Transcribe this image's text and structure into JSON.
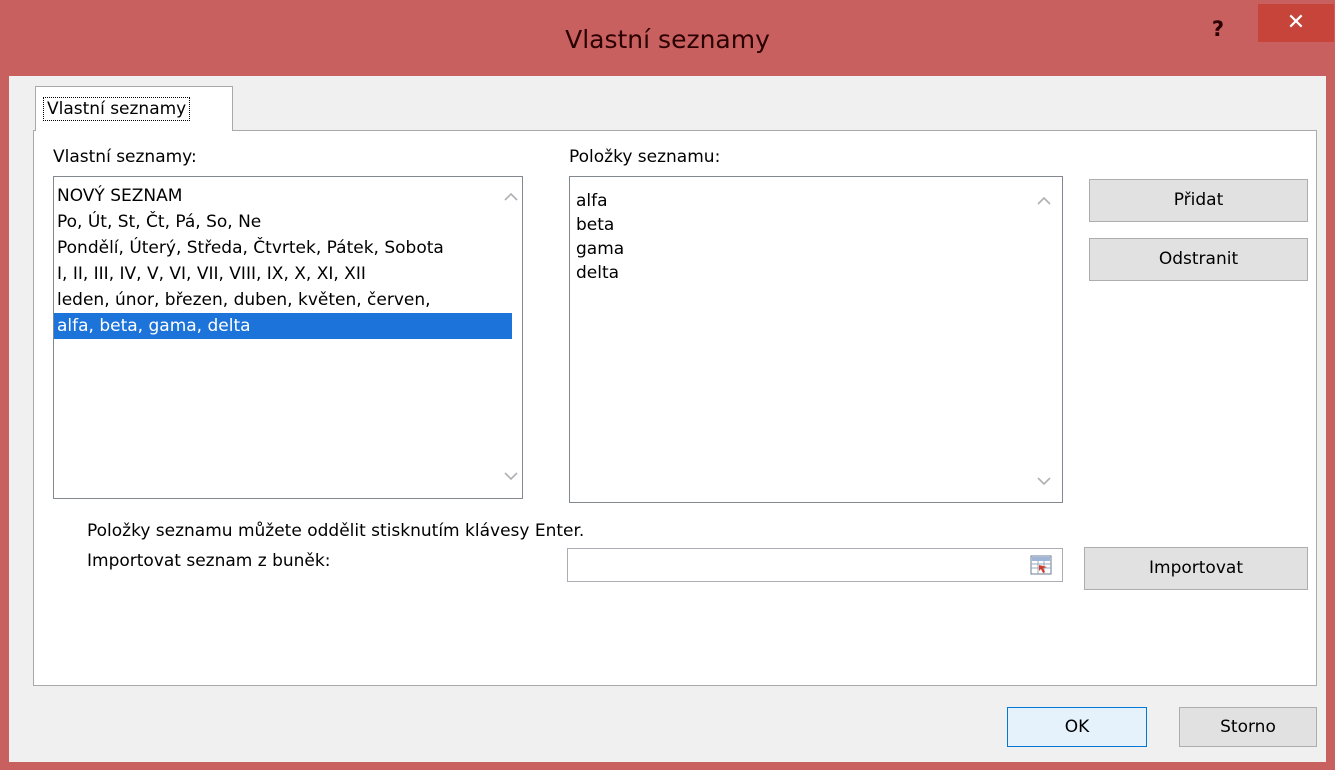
{
  "window": {
    "title": "Vlastní seznamy",
    "help_label": "?",
    "close_label": "✕"
  },
  "tab": {
    "label": "Vlastní seznamy"
  },
  "custom_lists": {
    "label": "Vlastní seznamy:",
    "items": [
      "NOVÝ SEZNAM",
      "Po, Út, St, Čt, Pá, So, Ne",
      "Pondělí, Úterý, Středa, Čtvrtek, Pátek, Sobota",
      "I, II, III, IV, V, VI, VII, VIII, IX, X, XI, XII",
      "leden, únor, březen, duben, květen, červen,",
      "alfa, beta, gama, delta"
    ],
    "selected_index": 5
  },
  "list_entries": {
    "label": "Položky seznamu:",
    "items": [
      "alfa",
      "beta",
      "gama",
      "delta"
    ]
  },
  "buttons": {
    "add": "Přidat",
    "remove": "Odstranit",
    "import": "Importovat",
    "ok": "OK",
    "cancel": "Storno"
  },
  "hint": "Položky seznamu můžete oddělit stisknutím klávesy Enter.",
  "import_label": "Importovat seznam z buněk:",
  "import_value": "",
  "icons": {
    "help": "help-icon",
    "close": "close-icon",
    "scroll_up": "chevron-up-icon",
    "scroll_down": "chevron-down-icon",
    "range_select": "range-select-icon"
  },
  "colors": {
    "titlebar": "#c8605f",
    "close_button": "#c7443a",
    "selection": "#1c73d9"
  }
}
